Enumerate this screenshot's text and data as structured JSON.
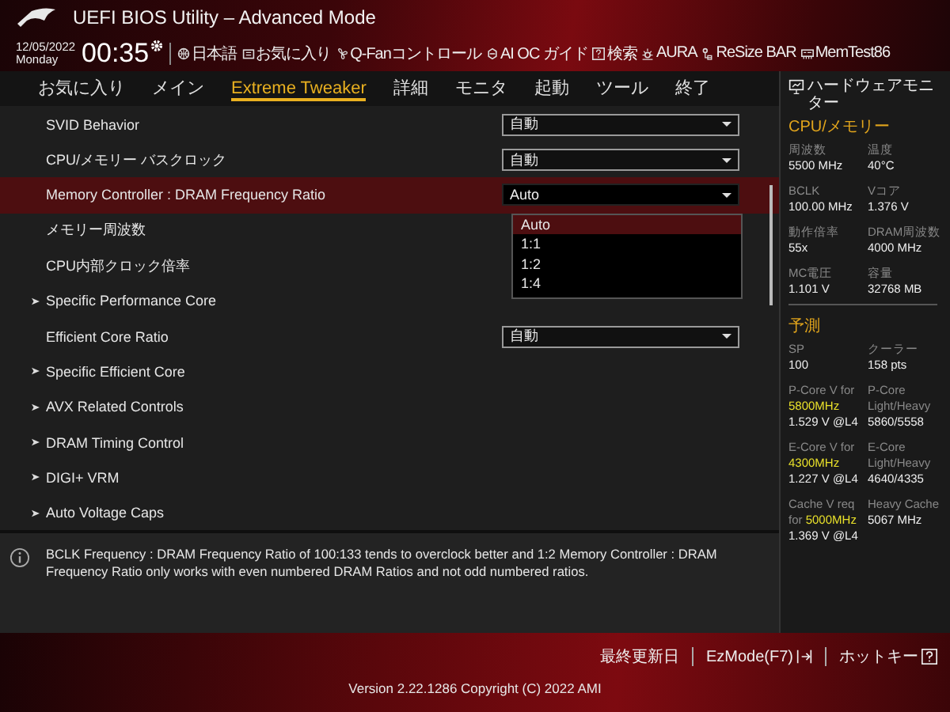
{
  "header": {
    "title": "UEFI BIOS Utility – Advanced Mode",
    "date": "12/05/2022",
    "weekday": "Monday",
    "time": "00:35"
  },
  "toolbar": [
    {
      "kind": "language",
      "label": "日本語"
    },
    {
      "kind": "favorites",
      "label": "お気に入り"
    },
    {
      "kind": "fan",
      "label": "Q-Fanコントロール"
    },
    {
      "kind": "guide",
      "label": "AI OC ガイド"
    },
    {
      "kind": "search",
      "label": "検索"
    },
    {
      "kind": "lighting",
      "label": "AURA"
    },
    {
      "kind": "resize",
      "label": "ReSize BAR"
    },
    {
      "kind": "memtest",
      "label": "MemTest86"
    }
  ],
  "tabs": [
    {
      "label": "お気に入り",
      "selected": false
    },
    {
      "label": "メイン",
      "selected": false
    },
    {
      "label": "Extreme Tweaker",
      "selected": true
    },
    {
      "label": "詳細",
      "selected": false
    },
    {
      "label": "モニタ",
      "selected": false
    },
    {
      "label": "起動",
      "selected": false
    },
    {
      "label": "ツール",
      "selected": false
    },
    {
      "label": "終了",
      "selected": false
    }
  ],
  "settings": [
    {
      "kind": "dropdown",
      "label": "SVID Behavior",
      "value": "自動",
      "selected": false
    },
    {
      "kind": "dropdown",
      "label": "CPU/メモリー バスクロック",
      "value": "自動",
      "selected": false
    },
    {
      "kind": "dropdown",
      "label": "Memory Controller : DRAM Frequency Ratio",
      "value": "Auto",
      "selected": true,
      "menu": [
        {
          "label": "Auto",
          "selected": true
        },
        {
          "label": "1:1",
          "selected": false
        },
        {
          "label": "1:2",
          "selected": false
        },
        {
          "label": "1:4",
          "selected": false
        }
      ]
    },
    {
      "kind": "plain",
      "label": "メモリー周波数",
      "selected": false
    },
    {
      "kind": "plain",
      "label": "CPU内部クロック倍率",
      "selected": false
    },
    {
      "kind": "submenu",
      "label": "Specific Performance Core",
      "selected": false
    },
    {
      "kind": "dropdown",
      "label": "Efficient Core Ratio",
      "value": "自動",
      "selected": false
    },
    {
      "kind": "submenu",
      "label": "Specific Efficient Core",
      "selected": false
    },
    {
      "kind": "submenu",
      "label": "AVX Related Controls",
      "selected": false
    },
    {
      "kind": "submenu",
      "label": "DRAM Timing Control",
      "selected": false
    },
    {
      "kind": "submenu",
      "label": "DIGI+ VRM",
      "selected": false
    },
    {
      "kind": "submenu",
      "label": "Auto Voltage Caps",
      "selected": false
    }
  ],
  "help_text": "BCLK Frequency : DRAM Frequency Ratio of 100:133 tends to overclock better and 1:2 Memory Controller : DRAM Frequency Ratio only works with even numbered DRAM Ratios and not odd numbered ratios.",
  "monitor": {
    "title": "ハードウェアモニター",
    "sections": [
      {
        "title": "CPU/メモリー",
        "items": [
          {
            "label": "周波数",
            "value": "5500 MHz"
          },
          {
            "label": "温度",
            "value": "40°C"
          },
          {
            "label": "BCLK",
            "value": "100.00 MHz"
          },
          {
            "label": "Vコア",
            "value": "1.376 V"
          },
          {
            "label": "動作倍率",
            "value": "55x"
          },
          {
            "label": "DRAM周波数",
            "value": "4000 MHz"
          },
          {
            "label": "MC電圧",
            "value": "1.101 V"
          },
          {
            "label": "容量",
            "value": "32768 MB"
          }
        ]
      },
      {
        "title": "予測",
        "items": [
          {
            "label": "SP",
            "value": "100"
          },
          {
            "label": "クーラー",
            "value": "158 pts"
          },
          {
            "label": "P-Core V for **5800MHz**",
            "value": "1.529 V @L4"
          },
          {
            "label": "P-Core Light/Heavy",
            "value": "5860/5558"
          },
          {
            "label": "E-Core V for **4300MHz**",
            "value": "1.227 V @L4"
          },
          {
            "label": "E-Core Light/Heavy",
            "value": "4640/4335"
          },
          {
            "label": "Cache V req for **5000MHz**",
            "value": "1.369 V @L4"
          },
          {
            "label": "Heavy Cache",
            "value": "5067 MHz"
          }
        ]
      }
    ]
  },
  "footer": {
    "last_modified": "最終更新日",
    "ezmode": "EzMode(F7)",
    "hotkeys": "ホットキー",
    "version": "Version 2.22.1286 Copyright (C) 2022 AMI"
  }
}
